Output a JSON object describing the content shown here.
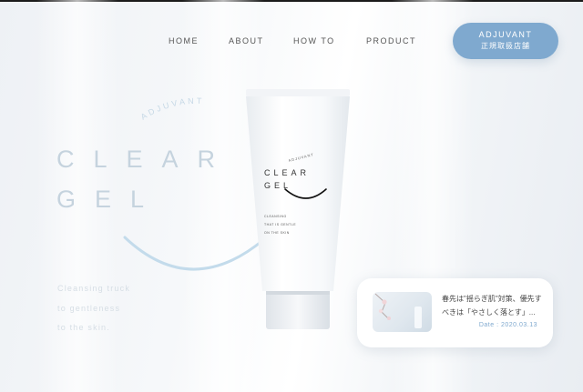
{
  "nav": {
    "home": "HOME",
    "about": "ABOUT",
    "howto": "HOW TO",
    "product": "PRODUCT"
  },
  "store_button": {
    "line1": "ADJUVANT",
    "line2": "正規取扱店舗"
  },
  "hero": {
    "brand_arc": "ADJUVANT",
    "word1": "CLEAR",
    "word2": "GEL",
    "tagline": [
      "Cleansing truck",
      "to gentleness",
      "to the skin."
    ]
  },
  "product": {
    "brand": "ADJUVANT",
    "name_line1": "CLEAR",
    "name_line2": "GEL",
    "desc": [
      "CLEANSING",
      "THAT IS GENTLE",
      "ON THE SKIN"
    ]
  },
  "news": {
    "title": "春先は\"揺らぎ肌\"対策、優先すべきは「やさしく落とす」...",
    "date": "Date : 2020.03.13"
  },
  "colors": {
    "accent": "#7fa9cf",
    "hero_text": "#c5d3de",
    "arc": "#c3dbeb"
  }
}
